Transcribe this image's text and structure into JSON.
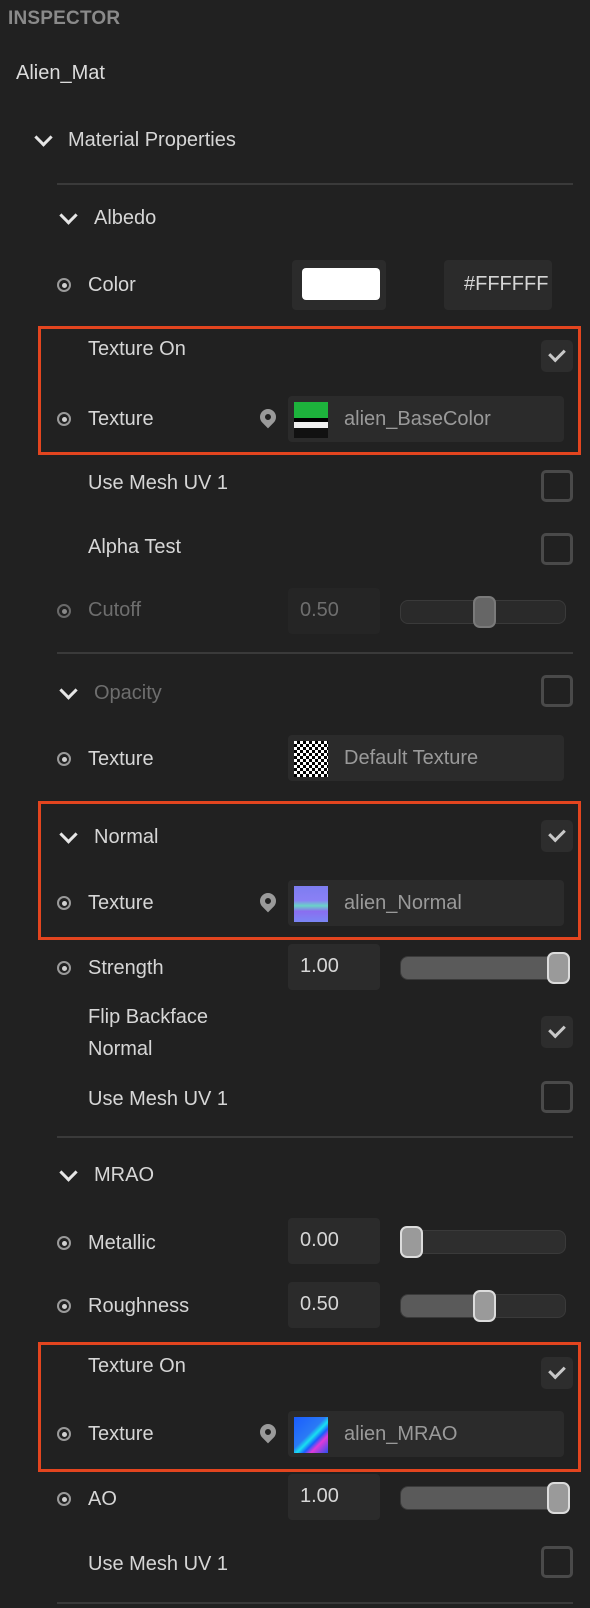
{
  "panel": {
    "title": "INSPECTOR",
    "material_name": "Alien_Mat"
  },
  "material_properties": {
    "label": "Material Properties",
    "expanded": true
  },
  "albedo": {
    "label": "Albedo",
    "color": {
      "label": "Color",
      "swatch": "#FFFFFF",
      "hex_value": "#FFFFFF"
    },
    "texture_on": {
      "label": "Texture On",
      "checked": true
    },
    "texture": {
      "label": "Texture",
      "name": "alien_BaseColor"
    },
    "use_mesh_uv1": {
      "label": "Use Mesh UV 1",
      "checked": false
    },
    "alpha_test": {
      "label": "Alpha Test",
      "checked": false
    },
    "cutoff": {
      "label": "Cutoff",
      "value": "0.50",
      "fraction": 0.5,
      "disabled": true
    }
  },
  "opacity": {
    "label": "Opacity",
    "checked": false,
    "texture": {
      "label": "Texture",
      "name": "Default Texture"
    }
  },
  "normal": {
    "label": "Normal",
    "checked": true,
    "texture": {
      "label": "Texture",
      "name": "alien_Normal"
    },
    "strength": {
      "label": "Strength",
      "value": "1.00",
      "fraction": 1.0
    },
    "flip_backface": {
      "label_line1": "Flip Backface",
      "label_line2": "Normal",
      "checked": true
    },
    "use_mesh_uv1": {
      "label": "Use Mesh UV 1",
      "checked": false
    }
  },
  "mrao": {
    "label": "MRAO",
    "metallic": {
      "label": "Metallic",
      "value": "0.00",
      "fraction": 0.0
    },
    "roughness": {
      "label": "Roughness",
      "value": "0.50",
      "fraction": 0.5
    },
    "texture_on": {
      "label": "Texture On",
      "checked": true
    },
    "texture": {
      "label": "Texture",
      "name": "alien_MRAO"
    },
    "ao": {
      "label": "AO",
      "value": "1.00",
      "fraction": 1.0
    },
    "use_mesh_uv1": {
      "label": "Use Mesh UV 1",
      "checked": false
    }
  },
  "highlight_color": "#E3451F"
}
